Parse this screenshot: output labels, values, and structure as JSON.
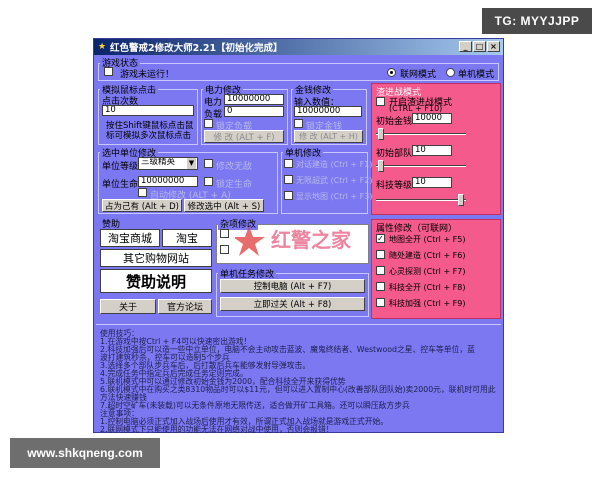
{
  "overlay": {
    "tg_tag": "TG: MYYJJPP",
    "site_tag": "www.shkqneng.com",
    "watermark_text": "红警之家",
    "watermark_url": "www.hjjzj.com"
  },
  "window": {
    "title": "红色警戒2修改大师2.21【初始化完成】",
    "min_label": "_",
    "max_label": "□",
    "close_label": "×"
  },
  "game_state": {
    "group_label": "游戏状态",
    "status_text": "游戏未运行！",
    "mode_online": "联网模式",
    "mode_single": "单机模式"
  },
  "mouse_sim": {
    "group_label": "模拟鼠标点击",
    "count_label": "点击次数",
    "count_value": "10",
    "hint_line1": "按住Shift键鼠标点击鼠",
    "hint_line2": "标可模拟多次鼠标点击"
  },
  "power_edit": {
    "group_label": "电力修改",
    "power_label": "电力",
    "power_value": "10000000",
    "load_label": "负载",
    "load_value": "0",
    "lock_label": "锁定负载",
    "button_label": "修 改 (ALT + F)"
  },
  "money_edit": {
    "group_label": "金钱修改",
    "input_label": "输入数值：",
    "value": "10000000",
    "lock_label": "锁定金钱",
    "button_label": "修 改 (ALT + H)"
  },
  "selected_unit": {
    "group_label": "选中单位修改",
    "level_label": "单位等级",
    "level_value": "三级精英",
    "hp_label": "单位生命",
    "hp_value": "10000000",
    "invincible_label": "修改无敌",
    "lock_hp_label": "锁定生命",
    "auto_label": "自动修改 (ALT + A)",
    "occupy_button": "占为己有 (Alt + D)",
    "modify_button": "修改选中 (Alt + S)"
  },
  "single_edit": {
    "group_label": "单机修改",
    "items": [
      "对话建造 (Ctrl + F1)",
      "无限超武 (Ctrl + F2)",
      "显示地图 (Ctrl + F3)"
    ]
  },
  "red_alert_mode": {
    "group_label": "渣进战模式",
    "enable_label": "开启渣进战模式",
    "hotkey": "(CTRL + F10)",
    "money_label": "初始金钱",
    "money_value": "10000",
    "army_label": "初始部队",
    "army_value": "10",
    "tech_label": "科技等级",
    "tech_value": "10"
  },
  "support": {
    "group_label": "赞助",
    "taobao_mall": "淘宝商城",
    "taobao": "淘宝",
    "other_shops": "其它购物网站",
    "sponsor_info": "赞助说明",
    "about": "关于",
    "forum": "官方论坛"
  },
  "misc": {
    "group_label": "杂项修改"
  },
  "single_task": {
    "group_label": "单机任务修改",
    "control_pc": "控制电脑 (Alt + F7)",
    "instant_win": "立即过关 (Alt + F8)"
  },
  "attr_edit": {
    "group_label": "属性修改（可联网）",
    "items": [
      {
        "label": "地图全开 (Ctrl + F5)",
        "checked": true
      },
      {
        "label": "随处建造 (Ctrl + F6)",
        "checked": false
      },
      {
        "label": "心灵探测 (Ctrl + F7)",
        "checked": false
      },
      {
        "label": "科技全开 (Ctrl + F8)",
        "checked": false
      },
      {
        "label": "科技加强 (Ctrl + F9)",
        "checked": false
      }
    ]
  },
  "info": {
    "lines": [
      "使用技巧：",
      "1.在游戏中按Ctrl + F4可以快速密出游戏！",
      "2.科技加强后可以造一些中立单位，电脑不会主动攻击蓝波、魔鬼终结者、Westwood之星、控车等单位，蓝",
      "波打建筑秒杀，控车可以造制5个步兵",
      "3.选择多个部队步兵车后，后打散后兵车能够发射导弹攻击。",
      "4.完成任务中指定兵后完成任务定则完成。",
      "5.联机模式中可以通过修改初始金钱为2000，配合科技全开来获得优势",
      "6.联机模式中在购买之类8310物品时可以$11元，但可以进入置制中心(改善部队团队始)卖2000元，联机时可用此",
      "方法快速赚钱",
      "7.超时空矿车(未装载)可以无条件原地无限传送，适合做开矿工具箱。还可以瞬压敌方步兵",
      "注意事项：",
      "1.控制电脑必须正式加入战场后使用才有效，所谓正式加入战场就是游戏正式开始。",
      "2.联网模式下只能使用的功能无法在网络对战中使用，否则会报错！"
    ]
  }
}
